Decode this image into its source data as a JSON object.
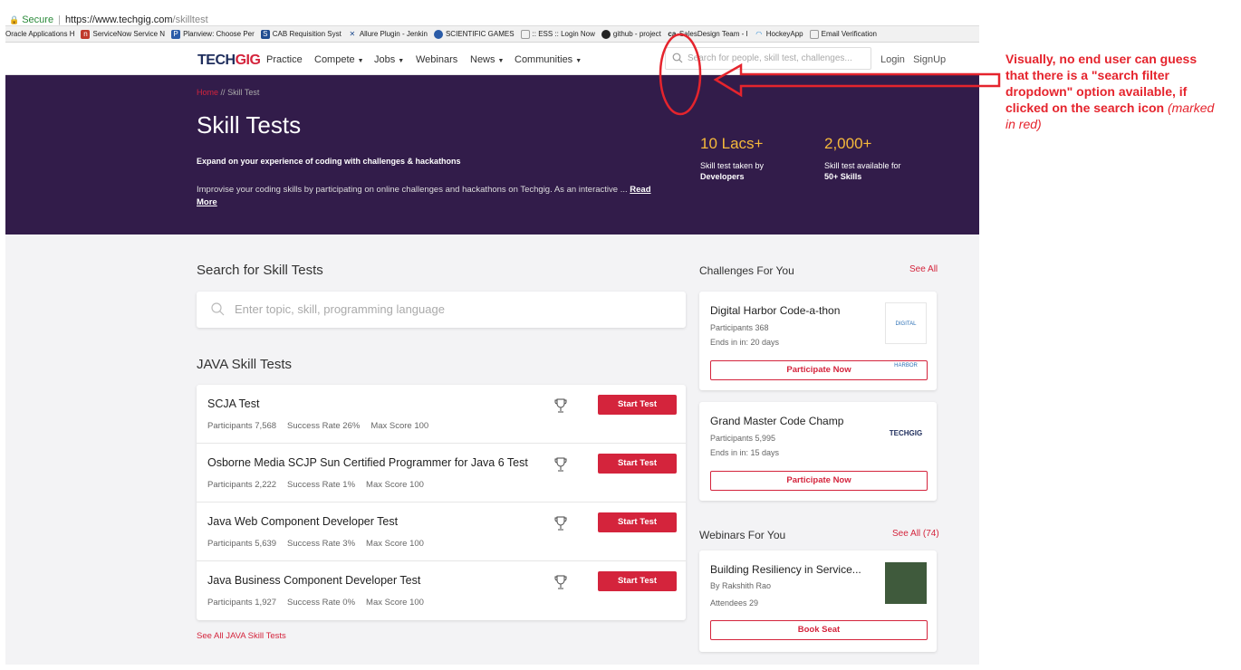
{
  "browser": {
    "secure_label": "Secure",
    "url_host": "https://www.techgig.com",
    "url_path": "/skilltest",
    "bookmarks": [
      "Oracle Applications H",
      "ServiceNow Service N",
      "Planview: Choose Per",
      "CAB Requisition Syst",
      "Allure Plugin - Jenkin",
      "SCIENTIFIC GAMES",
      ":: ESS :: Login Now",
      "github - project",
      "SalesDesign Team - I",
      "HockeyApp",
      "Email Verification"
    ]
  },
  "nav": {
    "logo_a": "TECH",
    "logo_b": "GIG",
    "items": [
      "Practice",
      "Compete",
      "Jobs",
      "Webinars",
      "News",
      "Communities"
    ],
    "search_placeholder": "Search for people, skill test, challenges...",
    "login": "Login",
    "signup": "SignUp"
  },
  "hero": {
    "crumb_home": "Home",
    "crumb_sep": "//",
    "crumb_current": "Skill Test",
    "title": "Skill Tests",
    "tagline": "Expand on your experience of coding with challenges & hackathons",
    "description": "Improvise your coding skills by participating on online challenges and hackathons on Techgig. As an interactive ...",
    "read_more": "Read More",
    "stat1_value": "10 Lacs+",
    "stat1_line1": "Skill test taken by",
    "stat1_line2": "Developers",
    "stat2_value": "2,000+",
    "stat2_line1": "Skill test available for",
    "stat2_line2": "50+ Skills"
  },
  "main": {
    "search_heading": "Search for Skill Tests",
    "search_placeholder": "Enter topic, skill, programming language",
    "java_heading": "JAVA Skill Tests",
    "start_label": "Start Test",
    "tests": [
      {
        "name": "SCJA Test",
        "participants": "Participants 7,568",
        "success": "Success Rate 26%",
        "max": "Max Score 100"
      },
      {
        "name": "Osborne Media SCJP Sun Certified Programmer for Java 6 Test",
        "participants": "Participants 2,222",
        "success": "Success Rate 1%",
        "max": "Max Score 100"
      },
      {
        "name": "Java Web Component Developer Test",
        "participants": "Participants 5,639",
        "success": "Success Rate 3%",
        "max": "Max Score 100"
      },
      {
        "name": "Java Business Component Developer Test",
        "participants": "Participants 1,927",
        "success": "Success Rate 0%",
        "max": "Max Score 100"
      }
    ],
    "see_all_java": "See All JAVA Skill Tests"
  },
  "side": {
    "challenges_heading": "Challenges For You",
    "challenges_see_all": "See All",
    "challenges": [
      {
        "title": "Digital Harbor Code-a-thon",
        "participants": "Participants 368",
        "ends": "Ends in in: 20 days",
        "button": "Participate Now",
        "logo": "DIGITAL HARBOR"
      },
      {
        "title": "Grand Master Code Champ",
        "participants": "Participants 5,995",
        "ends": "Ends in in: 15 days",
        "button": "Participate Now",
        "logo": "TECHGIG"
      }
    ],
    "webinars_heading": "Webinars For You",
    "webinars_see_all": "See All (74)",
    "webinar": {
      "title": "Building Resiliency in Service...",
      "by": "By Rakshith Rao",
      "attendees": "Attendees 29",
      "button": "Book Seat"
    }
  },
  "annotation": {
    "text": "Visually, no end user can guess that there is a \"search filter dropdown\" option available, if clicked on the search icon",
    "italic": "(marked in red)",
    "color": "#e5242d"
  }
}
